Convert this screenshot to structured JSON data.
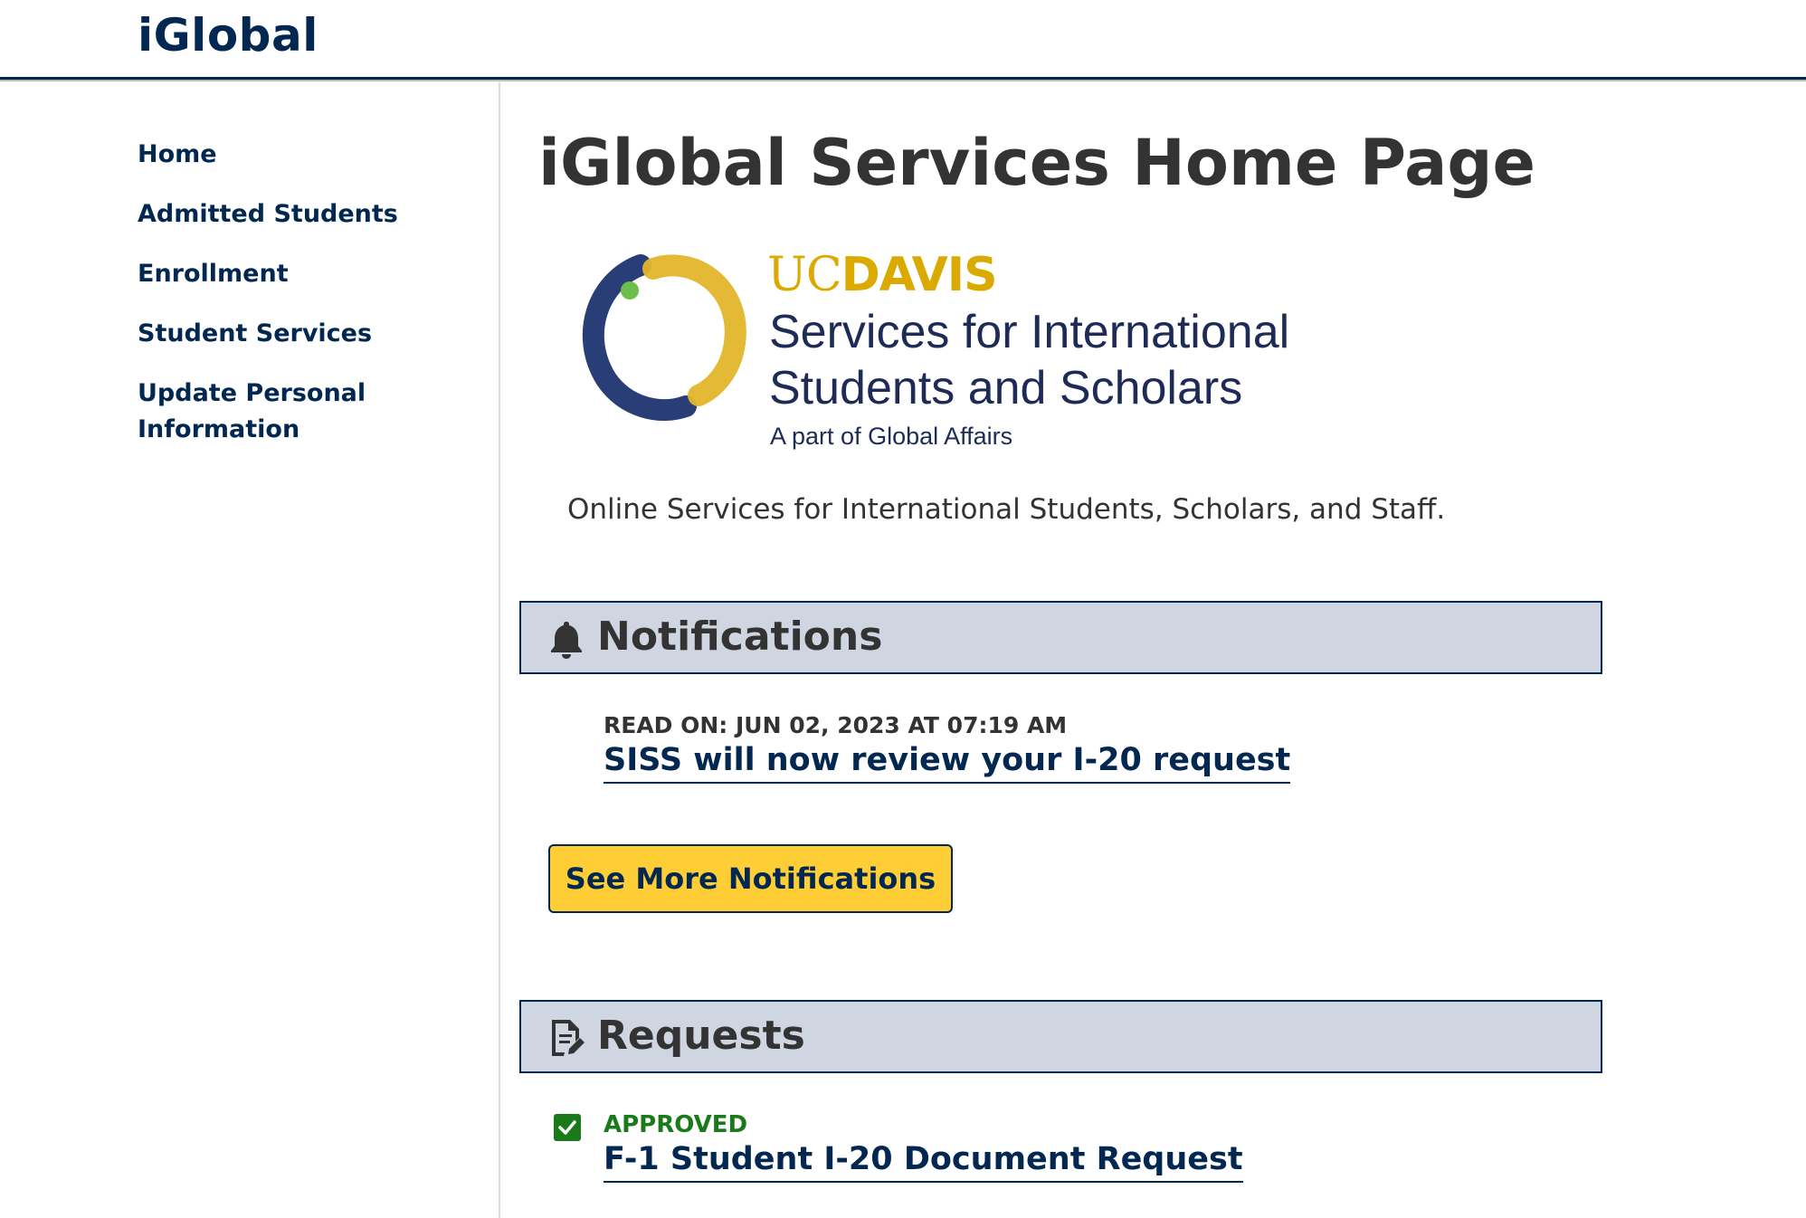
{
  "header": {
    "brand": "iGlobal"
  },
  "sidebar": {
    "items": [
      {
        "label": "Home"
      },
      {
        "label": "Admitted Students"
      },
      {
        "label": "Enrollment"
      },
      {
        "label": "Student Services"
      },
      {
        "label": "Update Personal Information"
      }
    ]
  },
  "main": {
    "title": "iGlobal Services Home Page",
    "logo": {
      "uc": "UC",
      "davis": "DAVIS",
      "line1": "Services for International",
      "line2": "Students and Scholars",
      "sub": "A part of Global Affairs"
    },
    "intro": "Online Services for International Students, Scholars, and Staff.",
    "notifications": {
      "title": "Notifications",
      "icon": "bell-icon",
      "items": [
        {
          "meta": "READ ON: JUN 02, 2023 AT 07:19 AM",
          "title": "SISS will now review your I-20 request"
        }
      ],
      "more_button": "See More Notifications"
    },
    "requests": {
      "title": "Requests",
      "icon": "document-edit-icon",
      "items": [
        {
          "status": "APPROVED",
          "status_icon": "checkbox-checked-icon",
          "title": "F-1 Student I-20 Document Request"
        }
      ]
    }
  },
  "colors": {
    "brand_navy": "#022851",
    "panel_bg": "#cfd6e1",
    "button_gold": "#ffcd35",
    "approved_green": "#1a7a1a",
    "ucdavis_gold": "#daaa00"
  }
}
